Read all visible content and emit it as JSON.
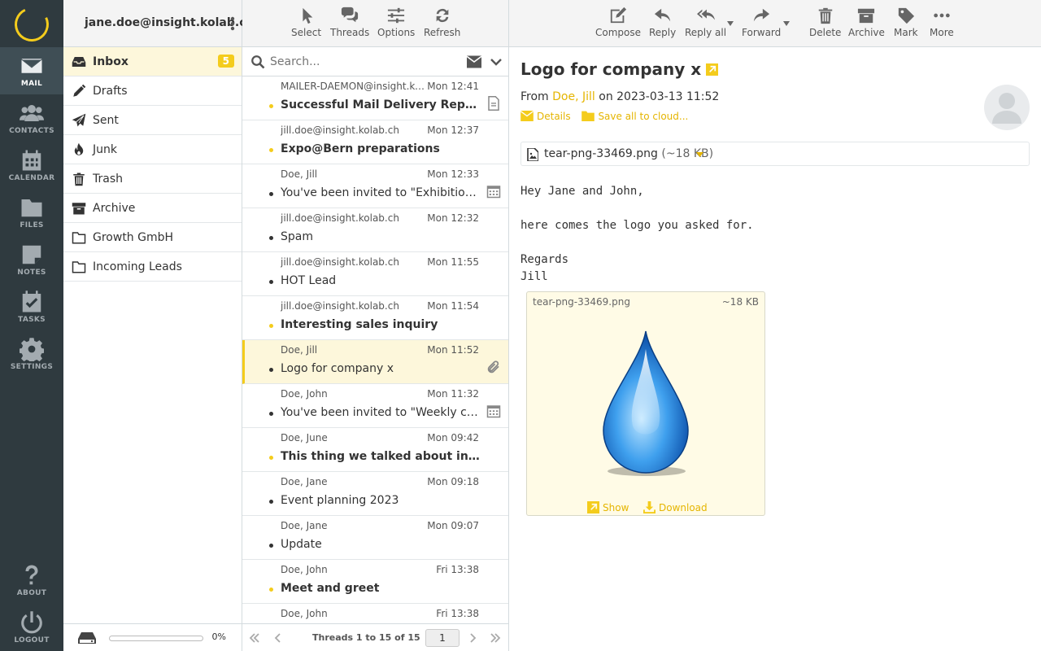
{
  "nav": {
    "items": [
      {
        "label": "MAIL",
        "icon": "envelope-icon"
      },
      {
        "label": "CONTACTS",
        "icon": "users-icon"
      },
      {
        "label": "CALENDAR",
        "icon": "calendar-icon"
      },
      {
        "label": "FILES",
        "icon": "folder-icon"
      },
      {
        "label": "NOTES",
        "icon": "note-icon"
      },
      {
        "label": "TASKS",
        "icon": "tasks-icon"
      },
      {
        "label": "SETTINGS",
        "icon": "gear-icon"
      }
    ],
    "about": "ABOUT",
    "logout": "LOGOUT"
  },
  "account": {
    "email": "jane.doe@insight.kolab.ch"
  },
  "folders": [
    {
      "label": "Inbox",
      "badge": "5"
    },
    {
      "label": "Drafts"
    },
    {
      "label": "Sent"
    },
    {
      "label": "Junk"
    },
    {
      "label": "Trash"
    },
    {
      "label": "Archive"
    },
    {
      "label": "Growth GmbH"
    },
    {
      "label": "Incoming Leads"
    }
  ],
  "quota": {
    "percent": "0%",
    "used_fraction": 0
  },
  "list_toolbar": {
    "select": "Select",
    "threads": "Threads",
    "options": "Options",
    "refresh": "Refresh"
  },
  "search": {
    "placeholder": "Search..."
  },
  "messages": [
    {
      "from": "MAILER-DAEMON@insight.kolab.ch",
      "date": "Mon 12:41",
      "subject": "Successful Mail Delivery Report",
      "unread": true,
      "icon": "report-icon"
    },
    {
      "from": "jill.doe@insight.kolab.ch",
      "date": "Mon 12:37",
      "subject": "Expo@Bern preparations",
      "unread": true
    },
    {
      "from": "Doe, Jill",
      "date": "Mon 12:33",
      "subject": "You've been invited to \"Exhibition @Bern\"",
      "unread": false,
      "icon": "calendar-icon"
    },
    {
      "from": "jill.doe@insight.kolab.ch",
      "date": "Mon 12:32",
      "subject": "Spam",
      "unread": false
    },
    {
      "from": "jill.doe@insight.kolab.ch",
      "date": "Mon 11:55",
      "subject": "HOT Lead",
      "unread": false
    },
    {
      "from": "jill.doe@insight.kolab.ch",
      "date": "Mon 11:54",
      "subject": "Interesting sales inquiry",
      "unread": true
    },
    {
      "from": "Doe, Jill",
      "date": "Mon 11:52",
      "subject": "Logo for company x",
      "unread": false,
      "selected": true,
      "icon": "paperclip-icon"
    },
    {
      "from": "Doe, John",
      "date": "Mon 11:32",
      "subject": "You've been invited to \"Weekly catch-up\"",
      "unread": false,
      "icon": "calendar-icon"
    },
    {
      "from": "Doe, June",
      "date": "Mon 09:42",
      "subject": "This thing we talked about in our test meeting",
      "unread": true
    },
    {
      "from": "Doe, Jane",
      "date": "Mon 09:18",
      "subject": "Event planning 2023",
      "unread": false
    },
    {
      "from": "Doe, Jane",
      "date": "Mon 09:07",
      "subject": "Update",
      "unread": false
    },
    {
      "from": "Doe, John",
      "date": "Fri 13:38",
      "subject": "Meet and greet",
      "unread": true
    },
    {
      "from": "Doe, John",
      "date": "Fri 13:38",
      "subject": "",
      "unread": false
    }
  ],
  "pager": {
    "count": "Threads 1 to 15 of 15",
    "page": "1"
  },
  "preview_toolbar": {
    "compose": "Compose",
    "reply": "Reply",
    "reply_all": "Reply all",
    "forward": "Forward",
    "delete": "Delete",
    "archive": "Archive",
    "mark": "Mark",
    "more": "More"
  },
  "email": {
    "subject": "Logo for company x",
    "from_prefix": "From",
    "from_name": "Doe, Jill",
    "date_text": "on 2023-03-13 11:52",
    "details": "Details",
    "save_cloud": "Save all to cloud...",
    "attachment_name": "tear-png-33469.png",
    "attachment_size": "(~18 KB)",
    "body": "Hey Jane and John,\n\nhere comes the logo you asked for.\n\nRegards\nJill",
    "image_name": "tear-png-33469.png",
    "image_size": "~18 KB",
    "show": "Show",
    "download": "Download"
  },
  "colors": {
    "accent": "#f4cc1c",
    "nav_bg": "#2f3a3f",
    "link": "#e5b500"
  }
}
